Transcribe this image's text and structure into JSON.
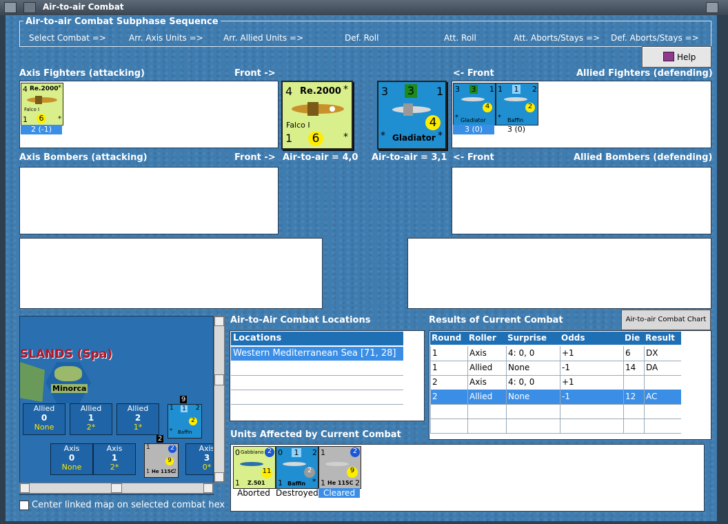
{
  "window": {
    "title": "Air-to-air Combat"
  },
  "sequence": {
    "title": "Air-to-air Combat Subphase Sequence",
    "steps": [
      "Select Combat =>",
      "Arr. Axis Units =>",
      "Arr. Allied Units =>",
      "Def. Roll",
      "Att. Roll",
      "Att. Aborts/Stays =>",
      "Def. Aborts/Stays =>"
    ]
  },
  "help": {
    "label": "Help"
  },
  "axis_fighters": {
    "header": "Axis Fighters (attacking)",
    "front": "Front ->",
    "unit": {
      "name": "Re.2000",
      "pilot": "Falco I",
      "tl": "4",
      "star": "*",
      "bl": "1",
      "val": "6",
      "caption": "2 (-1)"
    }
  },
  "allied_fighters": {
    "header": "Allied Fighters (defending)",
    "front": "<- Front",
    "units": [
      {
        "name": "Gladiator",
        "tl": "3",
        "box": "3",
        "tr": "1",
        "val": "4",
        "star": "*",
        "caption": "3 (0)"
      },
      {
        "name": "Baffin",
        "tl": "1",
        "box": "1",
        "tr": "2",
        "val": "2",
        "star": "*",
        "caption": "3 (0)"
      }
    ]
  },
  "front_axis": {
    "name": "Re.2000",
    "pilot": "Falco I",
    "tl": "4",
    "star": "*",
    "bl": "1",
    "val": "6",
    "label": "Air-to-air = 4,0"
  },
  "front_allied": {
    "name": "Gladiator",
    "tl": "3",
    "box": "3",
    "tr": "1",
    "val": "4",
    "star": "*",
    "label": "Air-to-air = 3,1"
  },
  "axis_bombers": {
    "header": "Axis Bombers (attacking)",
    "front": "Front ->"
  },
  "allied_bombers": {
    "header": "Allied Bombers (defending)",
    "front": "<- Front"
  },
  "map": {
    "region": "SLANDS (Spa)",
    "island": "Minorca",
    "allied_boxes": [
      {
        "title": "Allied",
        "n": "0",
        "s": "None"
      },
      {
        "title": "Allied",
        "n": "1",
        "s": "2*"
      },
      {
        "title": "Allied",
        "n": "2",
        "s": "1*"
      }
    ],
    "axis_boxes": [
      {
        "title": "Axis",
        "n": "0",
        "s": "None"
      },
      {
        "title": "Axis",
        "n": "1",
        "s": "2*"
      },
      {
        "title": "Axis",
        "n": "3",
        "s": "0*"
      }
    ],
    "stack1": {
      "count": "9",
      "name": "Baffin",
      "tl": "1",
      "box": "1",
      "tr": "2",
      "val": "2",
      "star": "*"
    },
    "stack2": {
      "count": "2",
      "name": "He 115C",
      "tl": "1",
      "tr": "2",
      "bl": "1",
      "br": "2",
      "val": "9"
    }
  },
  "center_checkbox": {
    "label": "Center linked map on selected combat hex"
  },
  "locations": {
    "header": "Air-to-Air Combat Locations",
    "column": "Locations",
    "items": [
      "Western Mediterranean Sea [71, 28]"
    ]
  },
  "results": {
    "header": "Results of Current Combat",
    "chart_button": "Air-to-air Combat Chart",
    "columns": [
      "Round",
      "Roller",
      "Surprise",
      "Odds",
      "Die",
      "Result"
    ],
    "rows": [
      [
        "1",
        "Axis",
        "4: 0, 0",
        "+1",
        "6",
        "DX"
      ],
      [
        "1",
        "Allied",
        "None",
        "-1",
        "14",
        "DA"
      ],
      [
        "2",
        "Axis",
        "4: 0, 0",
        "+1",
        "",
        ""
      ],
      [
        "2",
        "Allied",
        "None",
        "-1",
        "12",
        "AC"
      ]
    ]
  },
  "affected": {
    "header": "Units Affected by Current Combat",
    "units": [
      {
        "name": "Gabbiano",
        "sub": "Z.501",
        "tl": "0",
        "tr": "2",
        "bl": "1",
        "val": "11",
        "caption": "Aborted"
      },
      {
        "name": "Baffin",
        "tl": "0",
        "box": "1",
        "tr": "2",
        "bl": "1",
        "br": "*",
        "val": "2",
        "caption": "Destroyed"
      },
      {
        "name": "He 115C",
        "tl": "1",
        "tr": "2",
        "bl": "1",
        "br": "2",
        "val": "9",
        "caption": "Cleared"
      }
    ]
  },
  "colors": {
    "panel_blue": "#3f7cb0",
    "selection": "#3a8ee6",
    "axis_counter": "#d9ef8c",
    "allied_counter": "#1f8fd2"
  }
}
